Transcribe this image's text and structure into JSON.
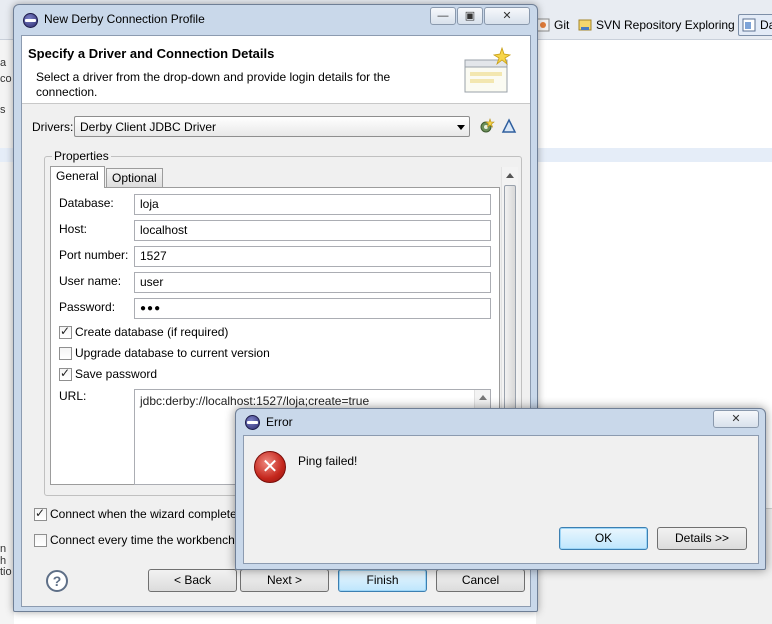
{
  "background": {
    "perspectives": [
      {
        "label": "Git"
      },
      {
        "label": "SVN Repository Exploring"
      },
      {
        "label": "Da"
      }
    ],
    "left_fragments": [
      "a",
      "co",
      "s",
      "n h",
      "tio"
    ]
  },
  "wizard": {
    "title": "New Derby Connection Profile",
    "header_title": "Specify a Driver and Connection Details",
    "header_description": "Select a driver from the drop-down and provide login details for the connection.",
    "drivers_label": "Drivers:",
    "driver_value": "Derby Client JDBC Driver",
    "properties_label": "Properties",
    "tabs": [
      {
        "label": "General"
      },
      {
        "label": "Optional"
      }
    ],
    "fields": {
      "database": {
        "label": "Database:",
        "value": "loja"
      },
      "host": {
        "label": "Host:",
        "value": "localhost"
      },
      "port": {
        "label": "Port number:",
        "value": "1527"
      },
      "user": {
        "label": "User name:",
        "value": "user"
      },
      "password": {
        "label": "Password:",
        "value": "●●●"
      }
    },
    "checkboxes": {
      "create_db": {
        "label": "Create database (if required)",
        "checked": true
      },
      "upgrade_db": {
        "label": "Upgrade database to current version",
        "checked": false
      },
      "save_password": {
        "label": "Save password",
        "checked": true
      }
    },
    "url_label": "URL:",
    "url_value": "jdbc:derby://localhost:1527/loja;create=true",
    "connect_on_finish": {
      "label": "Connect when the wizard completes",
      "checked": true
    },
    "connect_on_startup": {
      "label": "Connect every time the workbench i",
      "checked": false
    },
    "buttons": {
      "back": "< Back",
      "next": "Next >",
      "finish": "Finish",
      "cancel": "Cancel"
    }
  },
  "error_dialog": {
    "title": "Error",
    "message": "Ping failed!",
    "ok": "OK",
    "details": "Details >>"
  },
  "colors": {
    "window_frame": "#c9d8ea",
    "dialog_bg": "#f0f0f0",
    "error_red": "#c4261c",
    "default_button": "#bee6fd"
  }
}
